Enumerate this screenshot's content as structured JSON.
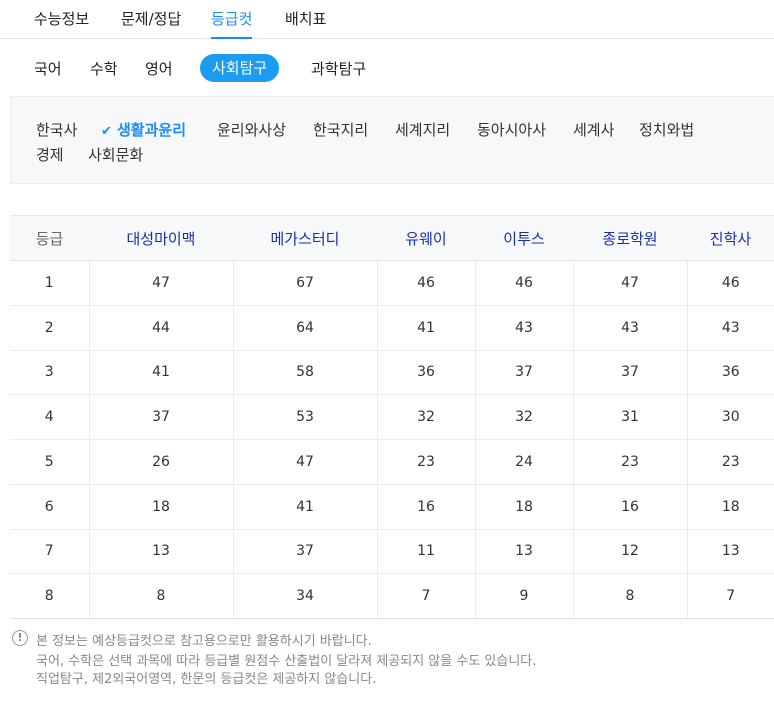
{
  "top_tabs": [
    "수능정보",
    "문제/정답",
    "등급컷",
    "배치표"
  ],
  "subject_tabs": [
    "국어",
    "수학",
    "영어",
    "사회탐구",
    "과학탐구"
  ],
  "sub_subjects": [
    "한국사",
    "생활과윤리",
    "윤리와사상",
    "한국지리",
    "세계지리",
    "동아시아사",
    "세계사",
    "정치와법",
    "경제",
    "사회문화"
  ],
  "table": {
    "headers": [
      "등급",
      "대성마이맥",
      "메가스터디",
      "유웨이",
      "이투스",
      "종로학원",
      "진학사"
    ],
    "rows": [
      [
        "1",
        "47",
        "67",
        "46",
        "46",
        "47",
        "46"
      ],
      [
        "2",
        "44",
        "64",
        "41",
        "43",
        "43",
        "43"
      ],
      [
        "3",
        "41",
        "58",
        "36",
        "37",
        "37",
        "36"
      ],
      [
        "4",
        "37",
        "53",
        "32",
        "32",
        "31",
        "30"
      ],
      [
        "5",
        "26",
        "47",
        "23",
        "24",
        "23",
        "23"
      ],
      [
        "6",
        "18",
        "41",
        "16",
        "18",
        "16",
        "18"
      ],
      [
        "7",
        "13",
        "37",
        "11",
        "13",
        "12",
        "13"
      ],
      [
        "8",
        "8",
        "34",
        "7",
        "9",
        "8",
        "7"
      ]
    ]
  },
  "notes": [
    "본 정보는 예상등급컷으로 참고용으로만 활용하시기 바랍니다.",
    "국어, 수학은 선택 과목에 따라 등급별 원점수 산출법이 달라져 제공되지 않을 수도 있습니다.",
    "직업탐구, 제2외국어영역, 한문의 등급컷은 제공하지 않습니다."
  ],
  "colors": {
    "accent": "#1b9cf2",
    "header_text": "#1a2db0"
  }
}
